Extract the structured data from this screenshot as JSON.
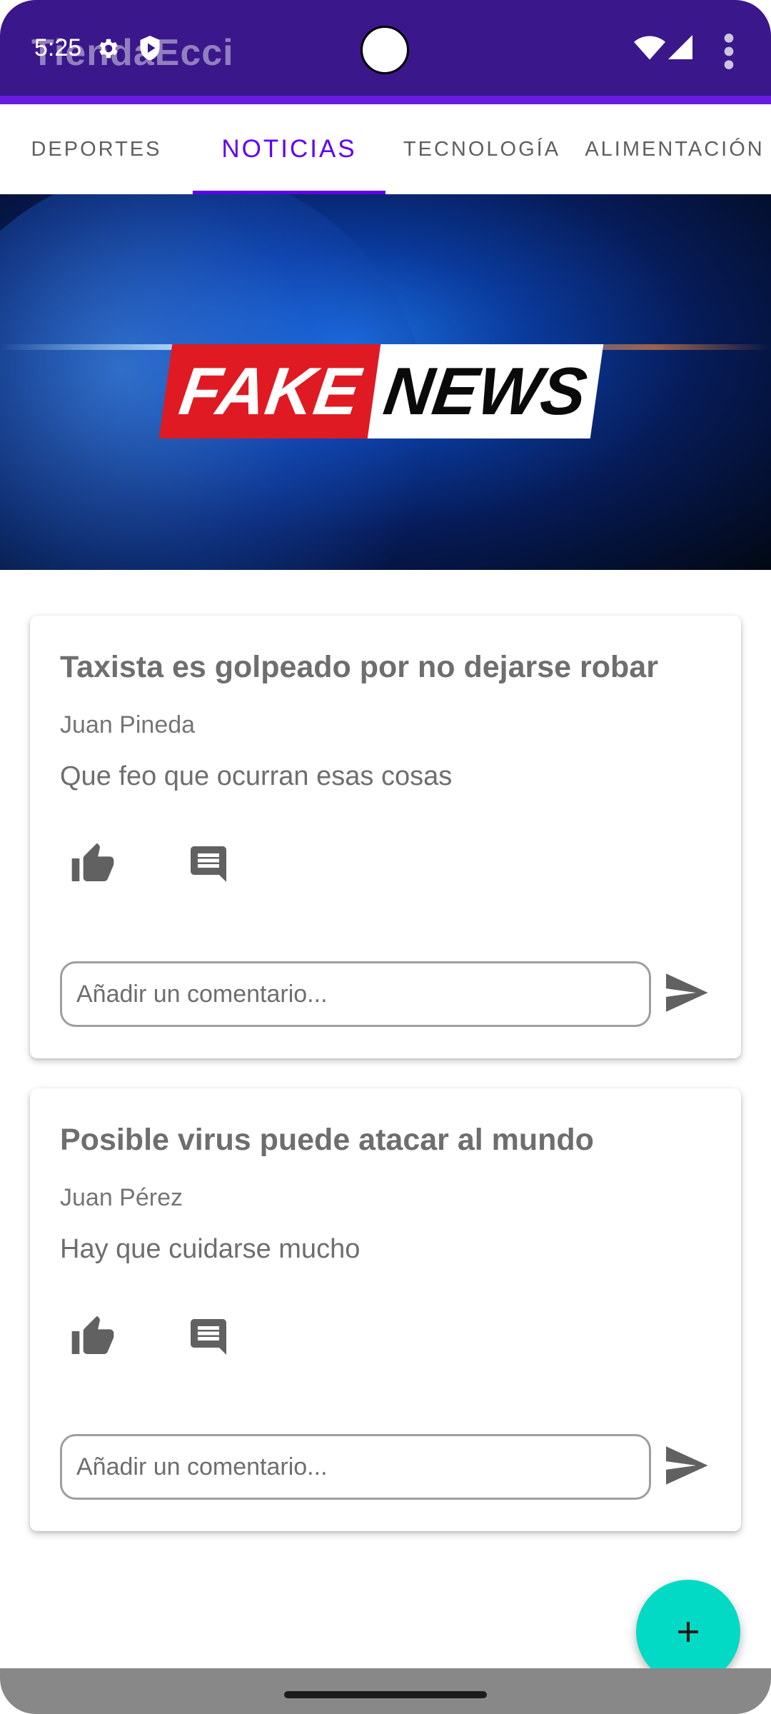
{
  "app": {
    "title": "TiendaEcci"
  },
  "status_bar": {
    "time": "5:25",
    "icons": [
      "gear-icon",
      "shield-icon",
      "wifi-icon",
      "cell-signal-icon"
    ]
  },
  "toolbar": {
    "overflow_icon": "more-vert-icon"
  },
  "tabs": [
    {
      "label": "DEPORTES",
      "active": false
    },
    {
      "label": "NOTICIAS",
      "active": true
    },
    {
      "label": "TECNOLOGÍA",
      "active": false
    },
    {
      "label": "ALIMENTACIÓN",
      "active": false
    }
  ],
  "banner": {
    "word1": "FAKE",
    "word2": "NEWS"
  },
  "posts": [
    {
      "title": "Taxista es golpeado por no dejarse robar",
      "author": "Juan Pineda",
      "body": "Que feo que ocurran esas cosas",
      "comment_placeholder": "Añadir un comentario..."
    },
    {
      "title": "Posible virus puede atacar al mundo",
      "author": "Juan Pérez",
      "body": "Hay que cuidarse mucho",
      "comment_placeholder": "Añadir un comentario..."
    }
  ],
  "fab": {
    "icon": "add-icon"
  },
  "colors": {
    "app_bar": "#3a178a",
    "accent": "#6200ee",
    "fab": "#03dac5",
    "banner_red": "#e01a22"
  }
}
